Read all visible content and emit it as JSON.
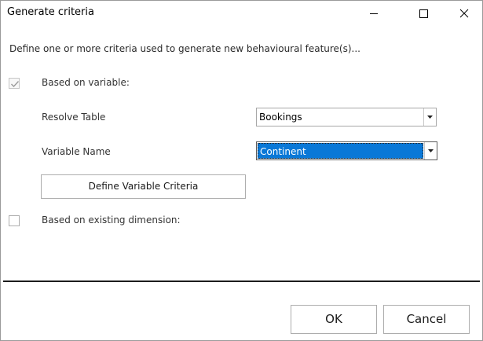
{
  "window": {
    "title": "Generate criteria"
  },
  "titlebar_buttons": {
    "minimize_icon": "minimize-icon",
    "maximize_icon": "maximize-icon",
    "close_icon": "close-icon"
  },
  "form": {
    "description": "Define one or more criteria used to generate new behavioural feature(s)...",
    "based_on_variable": {
      "label": "Based on variable:",
      "checked": true
    },
    "resolve_table": {
      "label": "Resolve Table",
      "value": "Bookings"
    },
    "variable_name": {
      "label": "Variable Name",
      "value": "Continent"
    },
    "define_button_label": "Define Variable Criteria",
    "based_on_dimension": {
      "label": "Based on existing dimension:",
      "checked": false
    }
  },
  "footer": {
    "ok_label": "OK",
    "cancel_label": "Cancel"
  },
  "colors": {
    "selection": "#0a78d7",
    "check_mark": "#9a9a9a"
  }
}
